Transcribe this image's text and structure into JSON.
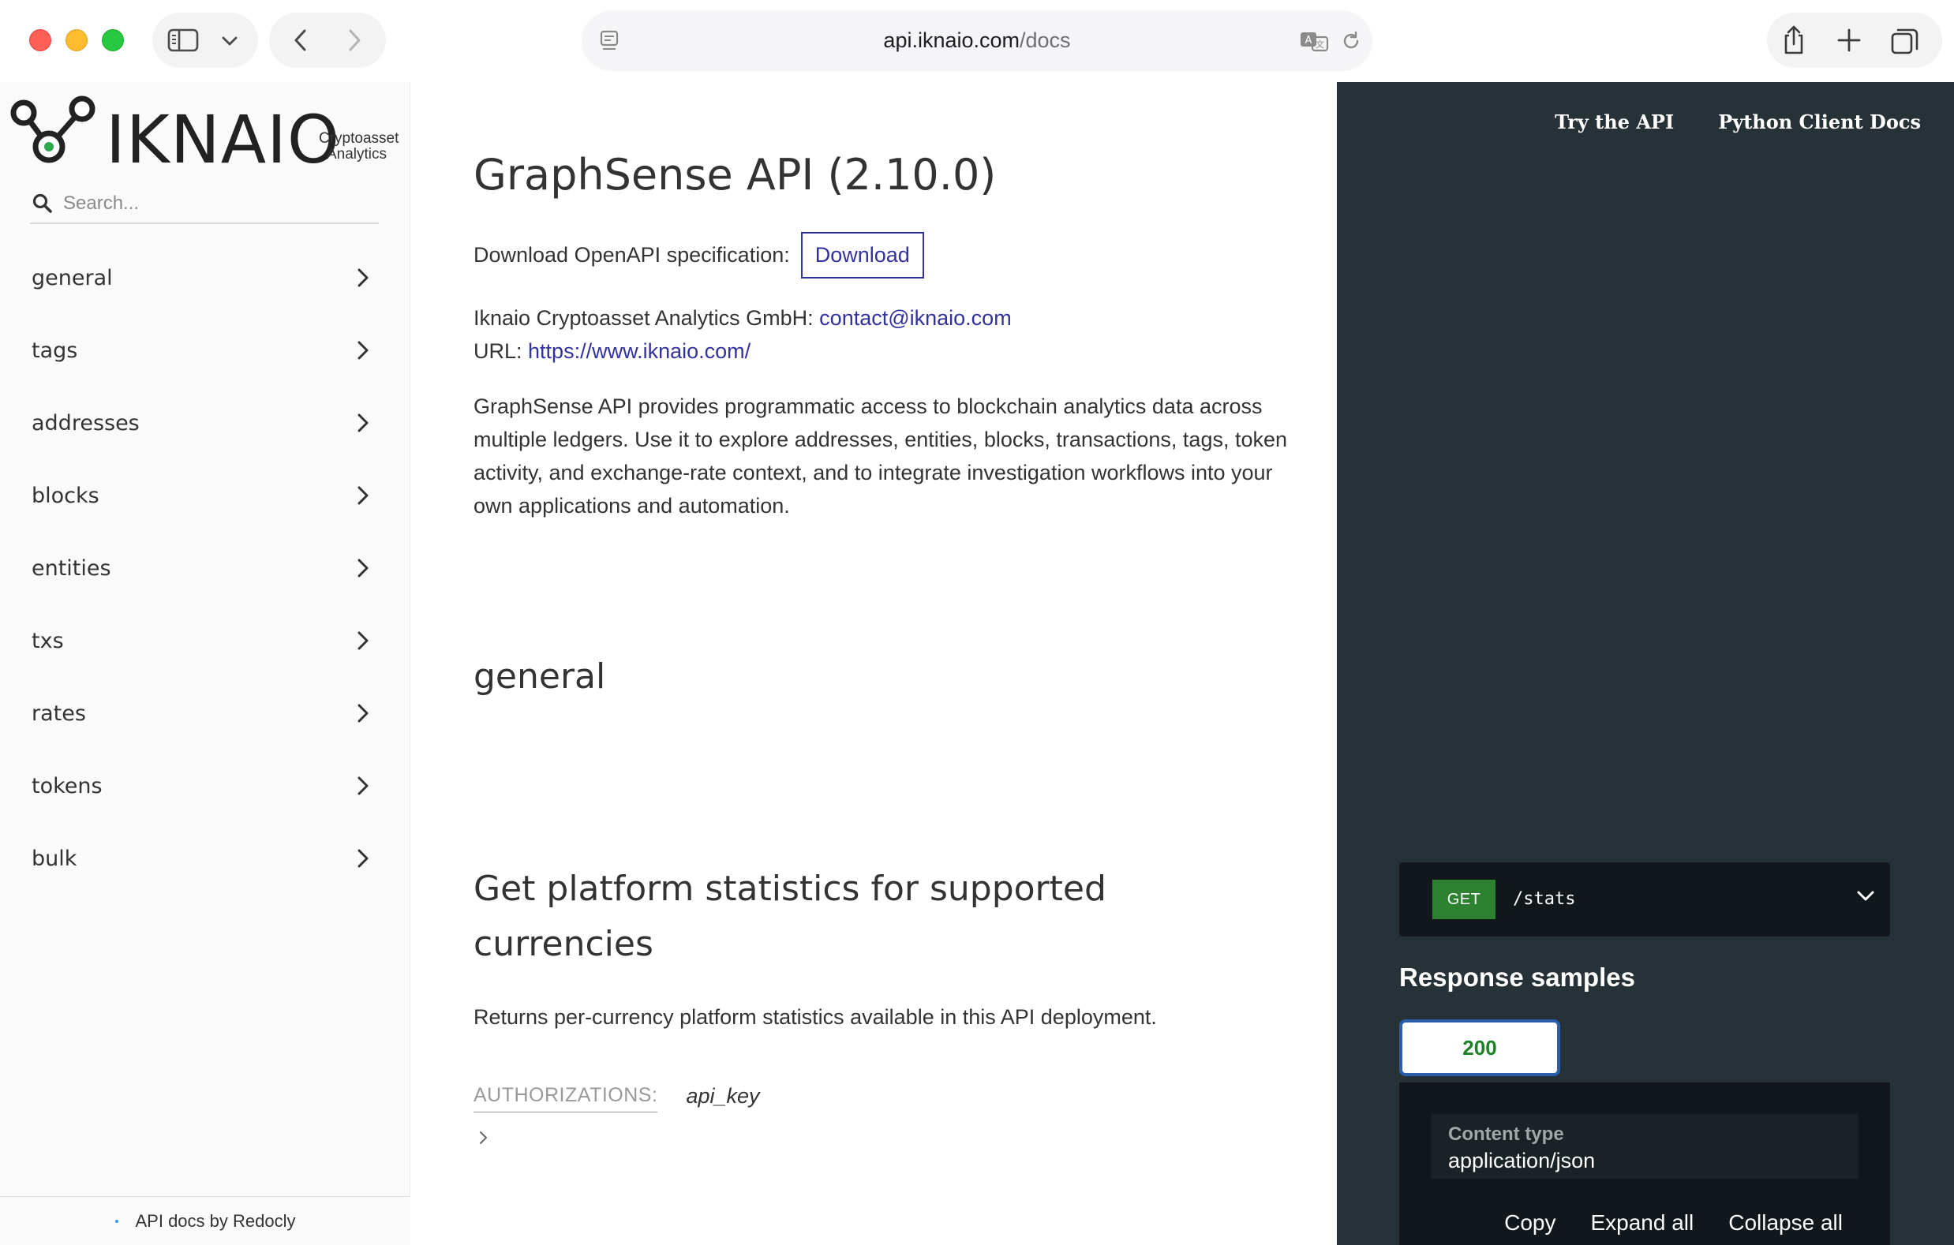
{
  "browser": {
    "url_domain": "api.iknaio.com",
    "url_path": "/docs"
  },
  "sidebar": {
    "logo_text": "IKNAIO",
    "logo_sub_line1": "Cryptoasset",
    "logo_sub_line2": "Analytics",
    "search_placeholder": "Search...",
    "items": [
      {
        "label": "general"
      },
      {
        "label": "tags"
      },
      {
        "label": "addresses"
      },
      {
        "label": "blocks"
      },
      {
        "label": "entities"
      },
      {
        "label": "txs"
      },
      {
        "label": "rates"
      },
      {
        "label": "tokens"
      },
      {
        "label": "bulk"
      }
    ],
    "footer": "API docs by Redocly"
  },
  "content": {
    "title": "GraphSense API (2.10.0)",
    "download_label": "Download OpenAPI specification:",
    "download_button": "Download",
    "contact_prefix": "Iknaio Cryptoasset Analytics GmbH: ",
    "contact_email": "contact@iknaio.com",
    "url_prefix": "URL: ",
    "url_link": "https://www.iknaio.com/",
    "description": "GraphSense API provides programmatic access to blockchain analytics data across multiple ledgers. Use it to explore addresses, entities, blocks, transactions, tags, token activity, and exchange-rate context, and to integrate investigation workflows into your own applications and automation.",
    "section_title": "general",
    "operation_title": "Get platform statistics for supported currencies",
    "operation_desc": "Returns per-currency platform statistics available in this API deployment.",
    "auth_label": "AUTHORIZATIONS:",
    "auth_value": "api_key"
  },
  "panel": {
    "links": [
      "Try the API",
      "Python Client Docs"
    ],
    "method": "GET",
    "path": "/stats",
    "response_title": "Response samples",
    "status_tab": "200",
    "content_type_label": "Content type",
    "content_type_value": "application/json",
    "actions": [
      "Copy",
      "Expand all",
      "Collapse all"
    ]
  },
  "colors": {
    "link": "#32329f",
    "panel_bg": "#263238",
    "get_badge": "#2f8132",
    "status_ok": "#1d8127"
  }
}
